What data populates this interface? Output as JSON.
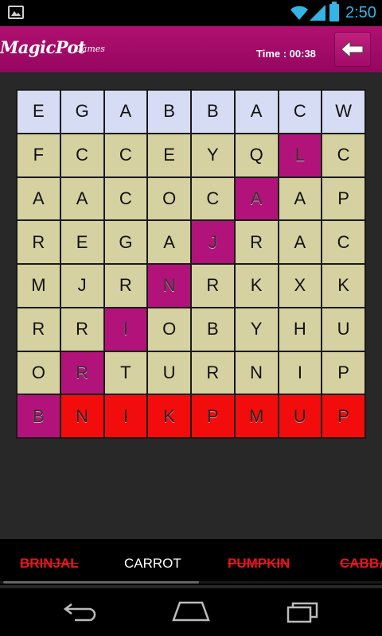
{
  "status": {
    "time": "2:50"
  },
  "header": {
    "logo_main": "MagicPot",
    "logo_sub": "Games",
    "timer": "Time : 00:38"
  },
  "grid": [
    [
      "E",
      "G",
      "A",
      "B",
      "B",
      "A",
      "C",
      "W"
    ],
    [
      "F",
      "C",
      "C",
      "E",
      "Y",
      "Q",
      "L",
      "C"
    ],
    [
      "A",
      "A",
      "C",
      "O",
      "C",
      "A",
      "A",
      "P"
    ],
    [
      "R",
      "E",
      "G",
      "A",
      "J",
      "R",
      "A",
      "C"
    ],
    [
      "M",
      "J",
      "R",
      "N",
      "R",
      "K",
      "X",
      "K"
    ],
    [
      "R",
      "R",
      "I",
      "O",
      "B",
      "Y",
      "H",
      "U"
    ],
    [
      "O",
      "R",
      "T",
      "U",
      "R",
      "N",
      "I",
      "P"
    ],
    [
      "B",
      "N",
      "I",
      "K",
      "P",
      "M",
      "U",
      "P"
    ]
  ],
  "words": [
    {
      "text": "BRINJAL",
      "status": "found"
    },
    {
      "text": "CARROT",
      "status": "pending"
    },
    {
      "text": "PUMPKIN",
      "status": "found"
    },
    {
      "text": "CABBA",
      "status": "found"
    }
  ],
  "colors": {
    "header": "#a00c68",
    "found_cell": "#b2137a",
    "red_cell": "#f20c0c",
    "cell": "#d6d1a1",
    "top_row": "#d5dcf3",
    "accent": "#33b5e5"
  }
}
